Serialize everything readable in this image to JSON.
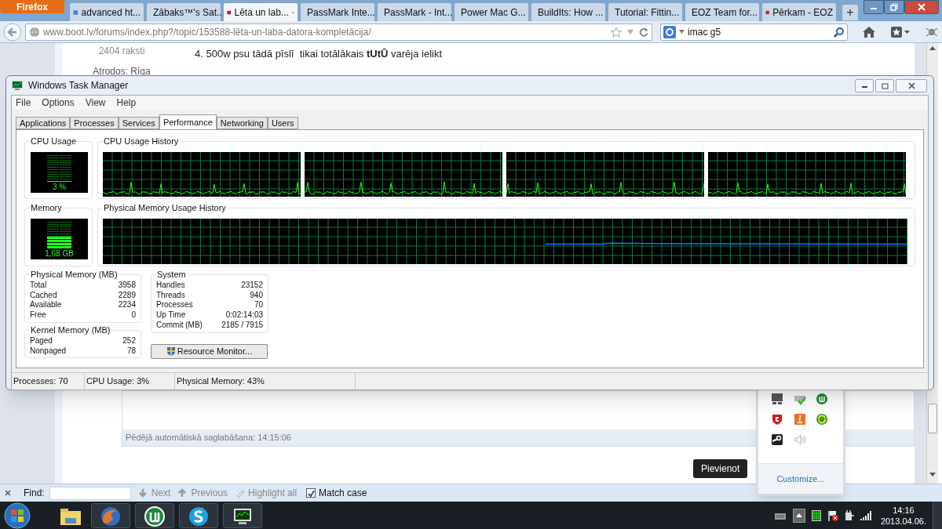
{
  "browser": {
    "app_button": "Firefox",
    "tabs": [
      {
        "title": "advanced ht...",
        "selected": false
      },
      {
        "title": "Zābaks™'s Sat...",
        "selected": false
      },
      {
        "title": "Lēta un lab...",
        "selected": true
      },
      {
        "title": "PassMark Inte...",
        "selected": false
      },
      {
        "title": "PassMark - Int...",
        "selected": false
      },
      {
        "title": "Power Mac G...",
        "selected": false
      },
      {
        "title": "BuildIts: How ...",
        "selected": false
      },
      {
        "title": "Tutorial: Fittin...",
        "selected": false
      },
      {
        "title": "EOZ Team for...",
        "selected": false
      },
      {
        "title": "Pērkam - EOZ",
        "selected": false
      }
    ],
    "new_tab": "+",
    "url": "www.boot.lv/forums/index.php?/topic/153588-lēta-un-laba-datora-kompletācija/",
    "search": {
      "value": "imac g5"
    }
  },
  "page": {
    "author_posts": "2404 raksti",
    "author_location": "Atrodos: Rīga",
    "post_text": "4. 500w psu tādā pīslī  tikai totālākais **tUtŪ** varēja ielikt",
    "autosave": "Pēdējā automātiskā saglabāšana: 14:15:06",
    "submit_button": "Pievienot"
  },
  "task_manager": {
    "title": "Windows Task Manager",
    "menu": [
      "File",
      "Options",
      "View",
      "Help"
    ],
    "tabs": [
      {
        "label": "Applications",
        "selected": false
      },
      {
        "label": "Processes",
        "selected": false
      },
      {
        "label": "Services",
        "selected": false
      },
      {
        "label": "Performance",
        "selected": true
      },
      {
        "label": "Networking",
        "selected": false
      },
      {
        "label": "Users",
        "selected": false
      }
    ],
    "cpu_usage": {
      "label": "CPU Usage",
      "reading": "3 %",
      "level": 0.03
    },
    "cpu_history": {
      "label": "CPU Usage History"
    },
    "memory": {
      "label": "Memory",
      "reading": "1,68 GB",
      "level": 0.43
    },
    "memory_history": {
      "label": "Physical Memory Usage History"
    },
    "physical_memory": {
      "title": "Physical Memory (MB)",
      "rows": [
        {
          "label": "Total",
          "value": "3958"
        },
        {
          "label": "Cached",
          "value": "2289"
        },
        {
          "label": "Available",
          "value": "2234"
        },
        {
          "label": "Free",
          "value": "0"
        }
      ]
    },
    "kernel_memory": {
      "title": "Kernel Memory (MB)",
      "rows": [
        {
          "label": "Paged",
          "value": "252"
        },
        {
          "label": "Nonpaged",
          "value": "78"
        }
      ]
    },
    "system": {
      "title": "System",
      "rows": [
        {
          "label": "Handles",
          "value": "23152"
        },
        {
          "label": "Threads",
          "value": "940"
        },
        {
          "label": "Processes",
          "value": "70"
        },
        {
          "label": "Up Time",
          "value": "0:02:14:03"
        },
        {
          "label": "Commit (MB)",
          "value": "2185 / 7915"
        }
      ]
    },
    "resource_monitor_button": "Resource Monitor...",
    "status_bar": [
      "Processes: 70",
      "CPU Usage: 3%",
      "Physical Memory: 43%"
    ]
  },
  "find_bar": {
    "label": "Find:",
    "buttons": [
      {
        "label": "Next",
        "disabled": true
      },
      {
        "label": "Previous",
        "disabled": true
      },
      {
        "label": "Highlight all",
        "disabled": true
      }
    ],
    "match_case": {
      "label": "Match case",
      "checked": true
    }
  },
  "tray_popup": {
    "link": "Customize..."
  },
  "taskbar": {
    "time": "14:16",
    "date": "2013.04.06."
  }
}
